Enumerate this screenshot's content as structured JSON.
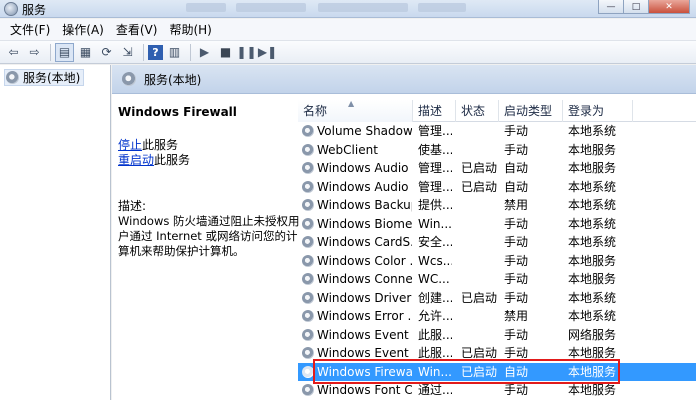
{
  "window": {
    "title": "服务",
    "controls": {
      "minimize": "—",
      "maximize": "□",
      "close": "✕"
    }
  },
  "menu": [
    "文件(F)",
    "操作(A)",
    "查看(V)",
    "帮助(H)"
  ],
  "toolbar_icons": [
    "back-icon",
    "forward-icon",
    "show-tree-icon",
    "properties-icon",
    "refresh-icon",
    "export-icon",
    "help-icon",
    "console-icon",
    "start-icon",
    "stop-icon",
    "pause-icon",
    "restart-icon"
  ],
  "tree": {
    "item": "服务(本地)"
  },
  "main": {
    "header": "服务(本地)",
    "selected_service": "Windows Firewall",
    "actions": [
      {
        "link": "停止",
        "suffix": "此服务"
      },
      {
        "link": "重启动",
        "suffix": "此服务"
      }
    ],
    "description_label": "描述:",
    "description_text": "Windows 防火墙通过阻止未授权用户通过 Internet 或网络访问您的计算机来帮助保护计算机。"
  },
  "columns": [
    "名称",
    "描述",
    "状态",
    "启动类型",
    "登录为"
  ],
  "rows": [
    {
      "name": "Volume Shadow...",
      "desc": "管理...",
      "status": "",
      "start": "手动",
      "logon": "本地系统"
    },
    {
      "name": "WebClient",
      "desc": "使基...",
      "status": "",
      "start": "手动",
      "logon": "本地服务"
    },
    {
      "name": "Windows Audio",
      "desc": "管理...",
      "status": "已启动",
      "start": "自动",
      "logon": "本地服务"
    },
    {
      "name": "Windows Audio ...",
      "desc": "管理...",
      "status": "已启动",
      "start": "自动",
      "logon": "本地系统"
    },
    {
      "name": "Windows Backup",
      "desc": "提供...",
      "status": "",
      "start": "禁用",
      "logon": "本地系统"
    },
    {
      "name": "Windows Biome...",
      "desc": "Win...",
      "status": "",
      "start": "手动",
      "logon": "本地系统"
    },
    {
      "name": "Windows CardS...",
      "desc": "安全...",
      "status": "",
      "start": "手动",
      "logon": "本地系统"
    },
    {
      "name": "Windows Color ...",
      "desc": "Wcs...",
      "status": "",
      "start": "手动",
      "logon": "本地服务"
    },
    {
      "name": "Windows Conne...",
      "desc": "WC...",
      "status": "",
      "start": "手动",
      "logon": "本地服务"
    },
    {
      "name": "Windows Driver ...",
      "desc": "创建...",
      "status": "已启动",
      "start": "手动",
      "logon": "本地系统"
    },
    {
      "name": "Windows Error ...",
      "desc": "允许...",
      "status": "",
      "start": "禁用",
      "logon": "本地系统"
    },
    {
      "name": "Windows Event ...",
      "desc": "此服...",
      "status": "",
      "start": "手动",
      "logon": "网络服务"
    },
    {
      "name": "Windows Event ...",
      "desc": "此服...",
      "status": "已启动",
      "start": "手动",
      "logon": "本地服务"
    },
    {
      "name": "Windows Firewall",
      "desc": "Win...",
      "status": "已启动",
      "start": "自动",
      "logon": "本地服务",
      "selected": true
    },
    {
      "name": "Windows Font C...",
      "desc": "通过...",
      "status": "",
      "start": "手动",
      "logon": "本地服务"
    }
  ],
  "colors": {
    "selection": "#3399ff",
    "highlight_box": "#e21b1b",
    "link": "#0033cc"
  }
}
